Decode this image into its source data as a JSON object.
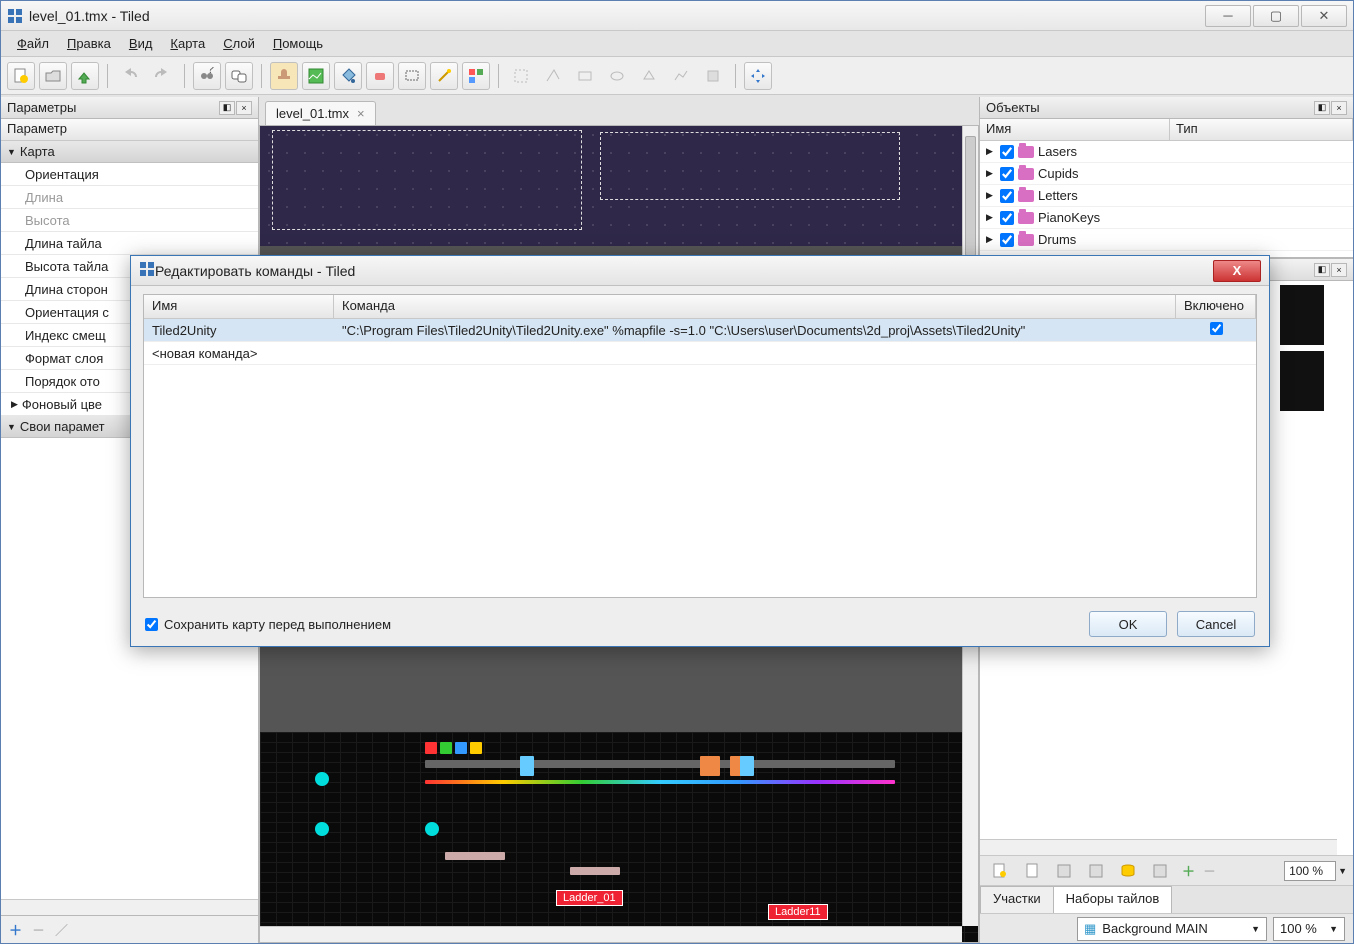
{
  "window": {
    "title": "level_01.tmx - Tiled"
  },
  "menu": [
    "Файл",
    "Правка",
    "Вид",
    "Карта",
    "Слой",
    "Помощь"
  ],
  "tabs": {
    "doc": "level_01.tmx"
  },
  "leftPanel": {
    "title": "Параметры",
    "header": "Параметр",
    "groups": [
      {
        "label": "Карта",
        "expanded": true,
        "rows": [
          {
            "label": "Ориентация",
            "dim": false
          },
          {
            "label": "Длина",
            "dim": true
          },
          {
            "label": "Высота",
            "dim": true
          },
          {
            "label": "Длина тайла",
            "dim": false
          },
          {
            "label": "Высота тайла",
            "dim": false
          },
          {
            "label": "Длина сторон",
            "dim": false
          },
          {
            "label": "Ориентация с",
            "dim": false
          },
          {
            "label": "Индекс смещ",
            "dim": false
          },
          {
            "label": "Формат слоя",
            "dim": false
          },
          {
            "label": "Порядок ото",
            "dim": false
          },
          {
            "label": "Фоновый цве",
            "dim": false
          }
        ]
      },
      {
        "label": "Свои парамет",
        "expanded": true,
        "rows": []
      }
    ]
  },
  "objects": {
    "title": "Объекты",
    "cols": [
      "Имя",
      "Тип"
    ],
    "rows": [
      "Lasers",
      "Cupids",
      "Letters",
      "PianoKeys",
      "Drums"
    ]
  },
  "tileset": {
    "zoom": "100 %",
    "tabs": [
      "Участки",
      "Наборы тайлов"
    ],
    "activeTab": 1,
    "bgSelect": "Background MAIN",
    "bgZoom": "100 %"
  },
  "canvasLabels": [
    "Ladder_01",
    "Ladder11"
  ],
  "dialog": {
    "title": "Редактировать команды - Tiled",
    "cols": [
      "Имя",
      "Команда",
      "Включено"
    ],
    "rows": [
      {
        "name": "Tiled2Unity",
        "cmd": "\"C:\\Program Files\\Tiled2Unity\\Tiled2Unity.exe\" %mapfile -s=1.0 \"C:\\Users\\user\\Documents\\2d_proj\\Assets\\Tiled2Unity\"",
        "enabled": true
      },
      {
        "name": "<новая команда>",
        "cmd": "",
        "enabled": null
      }
    ],
    "saveBefore": "Сохранить карту перед выполнением",
    "ok": "OK",
    "cancel": "Cancel"
  }
}
